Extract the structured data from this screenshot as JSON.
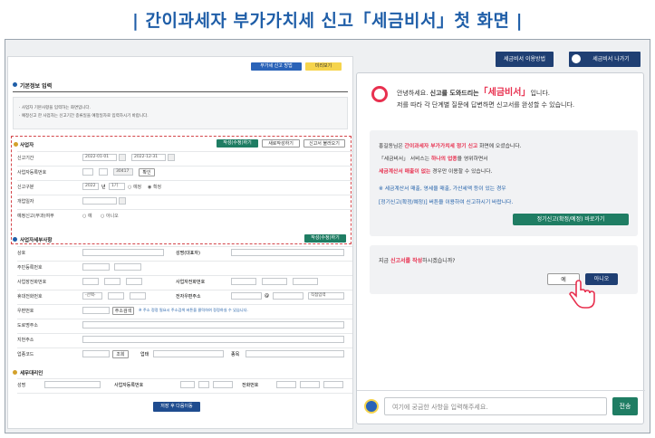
{
  "title": "| 간이과세자 부가가치세 신고「세금비서」첫 화면 |",
  "topbar": {
    "help": "세금비서 이용방법",
    "exit": "세금비서 나가기"
  },
  "left": {
    "btn_guide": "부가세 신고 방법",
    "btn_preview": "미리보기",
    "section_basic": "기본정보 입력",
    "notice1": "· 사업자 기본사항을 입력하는 화면입니다.",
    "notice2": "· 예정신고 한 사업자는 신고기간 종류일을 예정일자로 입력하시기 바랍니다.",
    "biz_label": "사업자",
    "btn_write": "작성(수정)하기",
    "btn_new": "새로작성하기",
    "btn_load": "신고서 불러오기",
    "f_period": "신고기간",
    "period_from": "2022-01-01",
    "period_to": "2022-12-31",
    "f_bizno": "사업자등록번호",
    "bizno_part": "30417",
    "btn_check": "확인",
    "f_type": "신고구분",
    "year": "2022",
    "year_unit": "년",
    "half": "1기",
    "opt_planned": "예정",
    "opt_final": "확정",
    "f_opendate": "개업일자",
    "f_planned": "예정신고(부과)여부",
    "opt_yes": "예",
    "opt_no": "아니오",
    "section_detail": "사업자세부사항",
    "btn_write2": "작성(수정)하기",
    "d_trade": "상호",
    "d_name": "성명(대표자)",
    "d_rrn": "주민등록번호",
    "d_biztel": "사업장전화번호",
    "d_biztel2": "사업자전화번호",
    "d_mobile": "휴대전화번호",
    "mobile_sel": "-선택-",
    "d_email": "전자우편주소",
    "email_at": "@",
    "email_sel": "직접입력",
    "d_zip": "우편번호",
    "btn_addr": "주소검색",
    "addr_note": "※ 주소 정정 필요시 주소검색 버튼을 클릭하여 정정하실 수 있습니다.",
    "d_road": "도로명주소",
    "d_lot": "지번주소",
    "d_industry": "업종코드",
    "btn_find": "조회",
    "d_biztype": "업태",
    "d_item": "종목",
    "section_agent": "세무대리인",
    "a_name": "성명",
    "a_bizno": "사업자등록번호",
    "a_tel": "전화번호",
    "btn_save": "저장 후 다음이동"
  },
  "right": {
    "greet1_pre": "안녕하세요. ",
    "greet1_bold": "신고를 도와드리는",
    "greet1_brand": "「세금비서」",
    "greet1_post": "입니다.",
    "greet2": "저를 따라 각 단계별 질문에 답변하면 신고서를 완성할 수 있습니다.",
    "m1_pre": "홍길동님은 ",
    "m1_red": "간이과세자 부가가치세 정기 신고",
    "m1_post": " 화면에 오셨습니다.",
    "m2_pre": "「세금비서」 서비스는 ",
    "m2_red": "하나의 업종",
    "m2_post": "을 영위하면서",
    "m3_red": "세금계산서 매출이 없는",
    "m3_post": " 경우만 이용할 수 있습니다.",
    "m4": "※ 세금계산서 매출, 영세율 매출, 가산세액 등이 있는 경우",
    "m5": "[정기신고(확정/예정)] 버튼을 이용하여 신고하시기 바랍니다.",
    "btn_direct": "정기신고(확정/예정) 바로가기",
    "q_pre": "지금 ",
    "q_red": "신고서를 작성",
    "q_post": "하시겠습니까?",
    "btn_yes": "예",
    "btn_no": "아니오",
    "input_placeholder": "여기에 궁금한 사항을 입력해주세요.",
    "btn_send": "전송"
  },
  "colors": {
    "title": "#1f5ea8",
    "brand": "#e8304f",
    "green": "#1f7d63",
    "navy": "#1f3f73"
  }
}
